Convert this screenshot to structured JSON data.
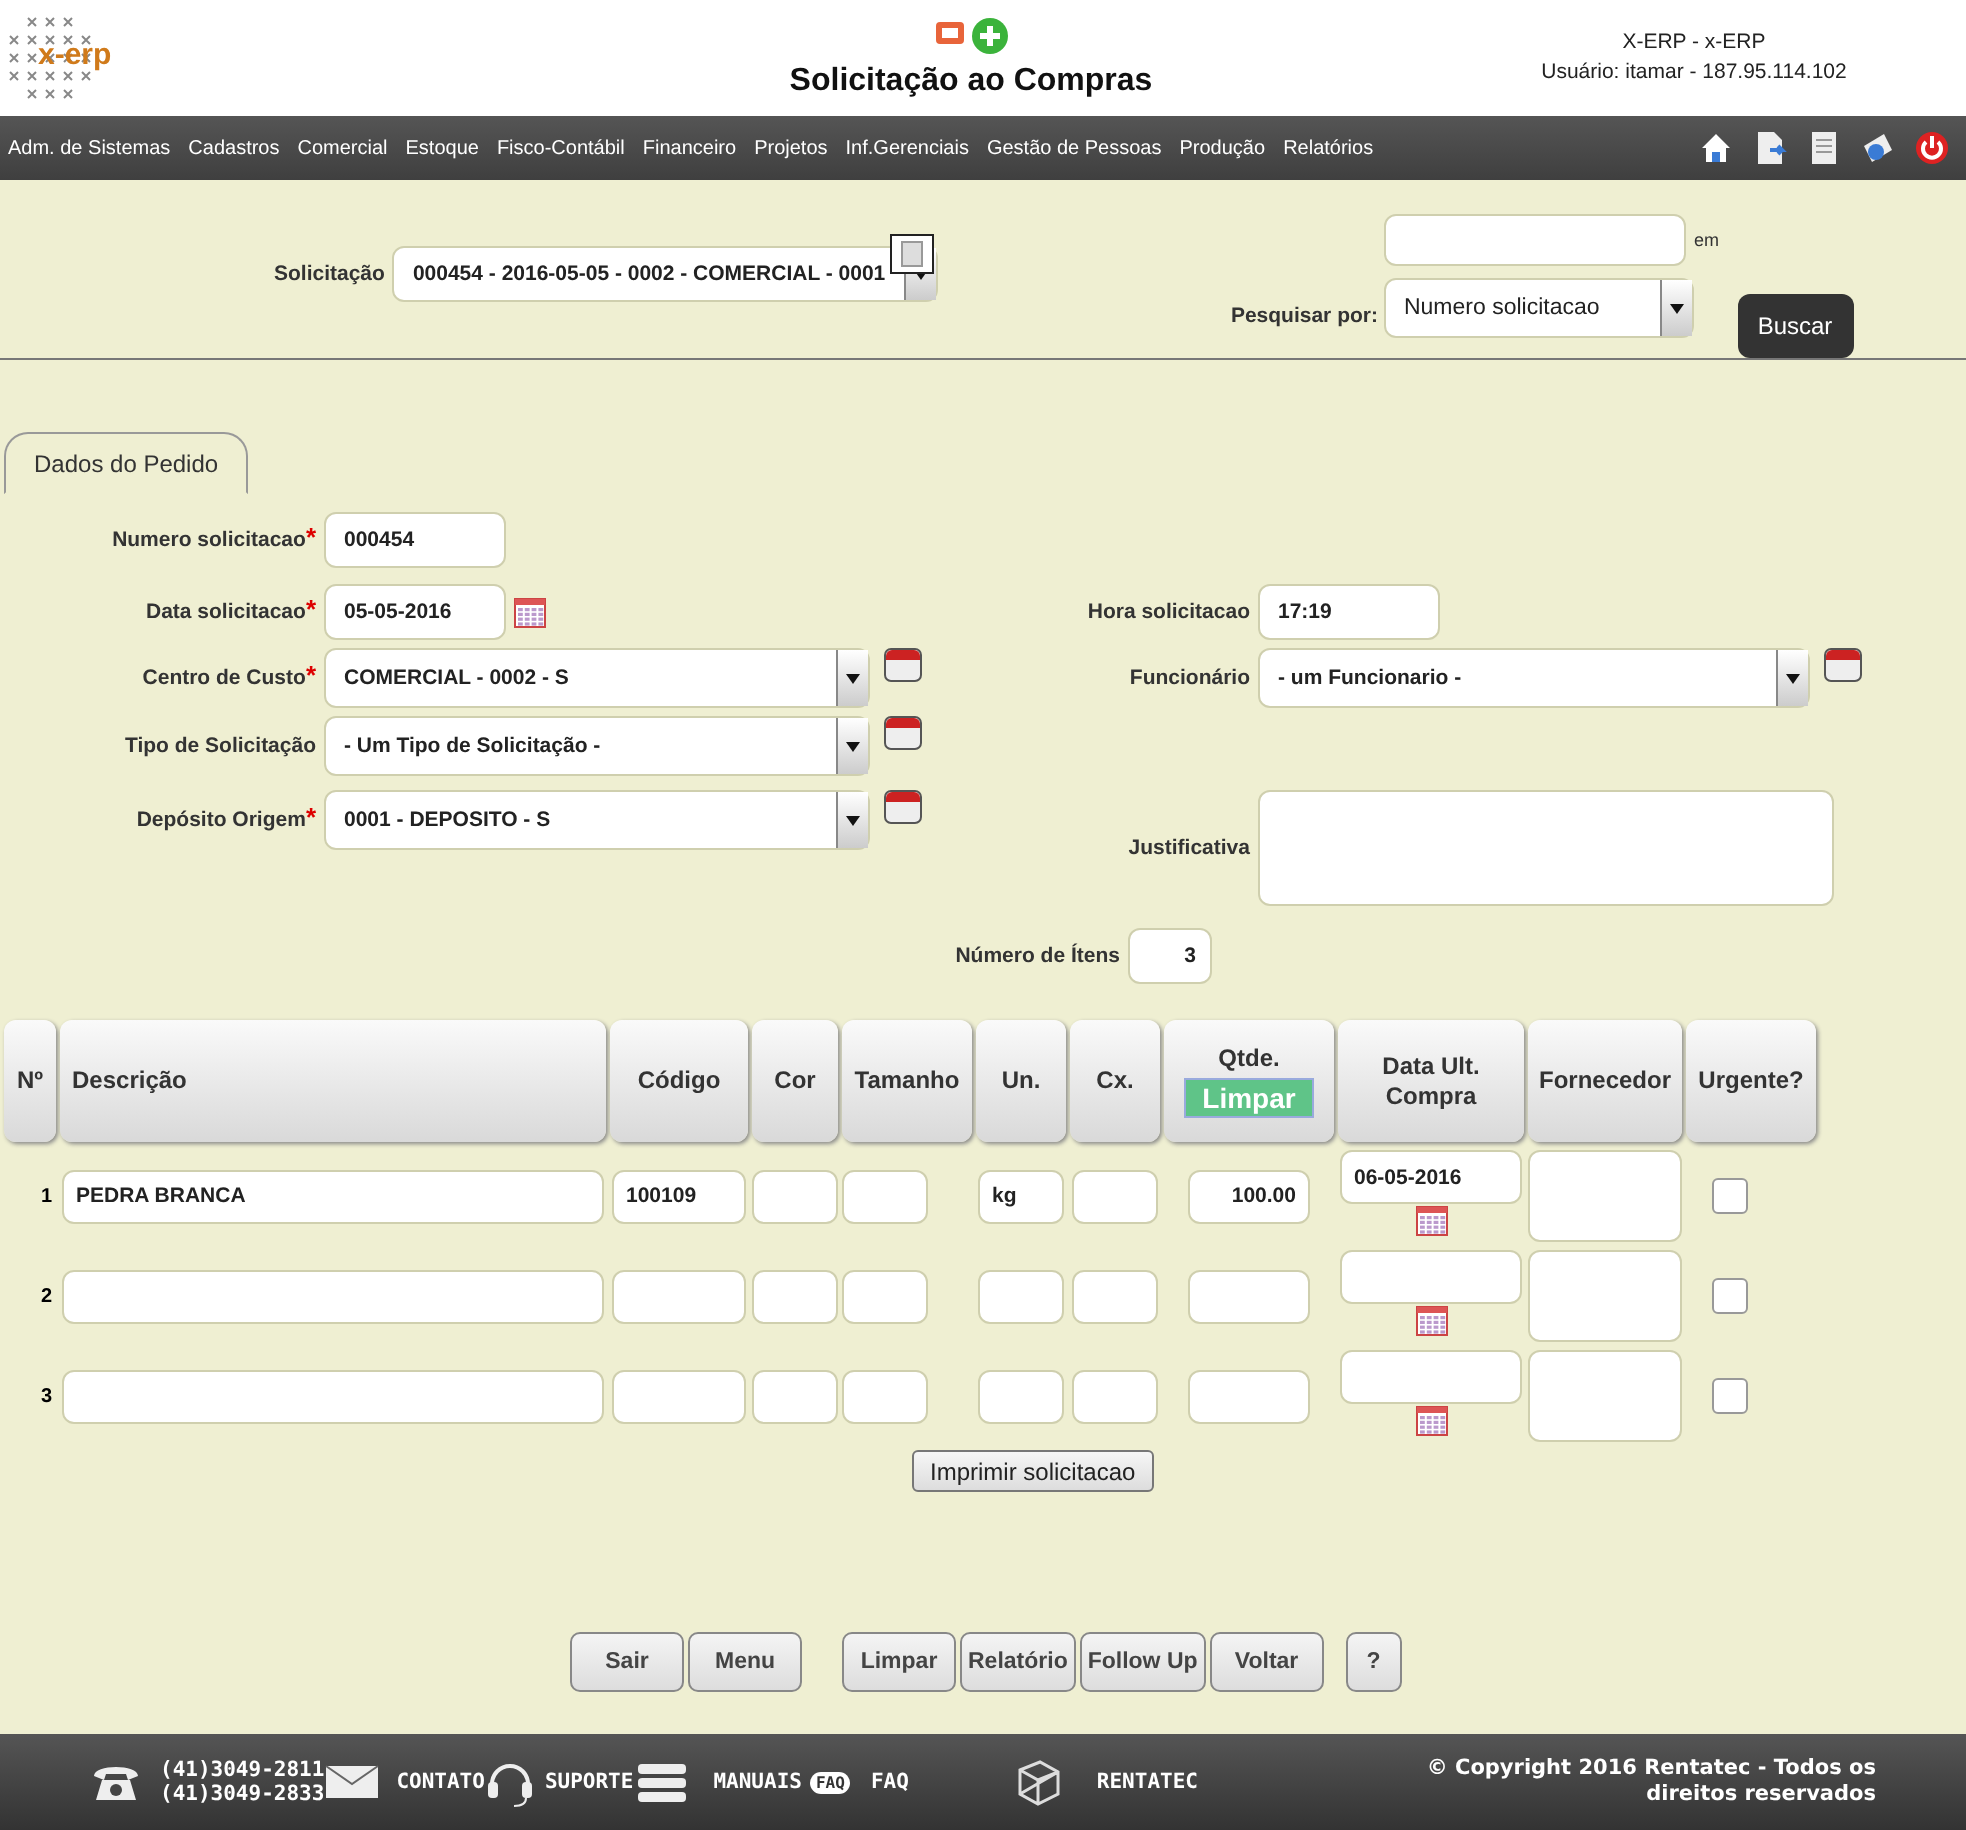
{
  "header": {
    "logo_text": "x-erp",
    "title": "Solicitação ao Compras",
    "system": "X-ERP - x-ERP",
    "user": "Usuário: itamar - 187.95.114.102"
  },
  "menu": [
    "Adm. de Sistemas",
    "Cadastros",
    "Comercial",
    "Estoque",
    "Fisco-Contábil",
    "Financeiro",
    "Projetos",
    "Inf.Gerenciais",
    "Gestão de Pessoas",
    "Produção",
    "Relatórios"
  ],
  "search": {
    "solicitacao_label": "Solicitação",
    "solicitacao_value": "000454 - 2016-05-05 - 0002 - COMERCIAL - 0001",
    "label": "Pesquisar por:",
    "suffix": "em",
    "field_value": "Numero solicitacao",
    "button": "Buscar"
  },
  "tabs": [
    {
      "label": "Dados do Pedido",
      "selected": true
    }
  ],
  "form": [
    {
      "left": {
        "label": "Numero solicitacao",
        "required": true,
        "kind": "text",
        "value": "000454"
      }
    },
    {
      "left": {
        "label": "Data solicitacao",
        "required": true,
        "kind": "date",
        "value": "05-05-2016"
      },
      "right": {
        "label": "Hora solicitacao",
        "required": false,
        "kind": "text",
        "value": "17:19"
      }
    },
    {
      "left": {
        "label": "Centro de Custo",
        "required": true,
        "kind": "select",
        "value": "COMERCIAL - 0002 - S"
      },
      "right": {
        "label": "Funcionário",
        "required": false,
        "kind": "select",
        "value": "- um Funcionario -"
      }
    },
    {
      "left": {
        "label": "Tipo de Solicitação",
        "required": false,
        "kind": "select",
        "value": "- Um Tipo de Solicitação -"
      }
    },
    {
      "left": {
        "label": "Depósito Origem",
        "required": true,
        "kind": "select",
        "value": "0001 - DEPOSITO - S"
      },
      "right": {
        "label": "Justificativa",
        "required": false,
        "kind": "textarea"
      }
    }
  ],
  "required_mark": "*",
  "items_count": {
    "label": "Número de Ítens",
    "value": "3"
  },
  "table": {
    "columns": [
      "Nº",
      "Descrição",
      "Código",
      "Cor",
      "Tamanho",
      "Un.",
      "Cx.",
      "Qtde.",
      "Data Ult. Compra",
      "Fornecedor",
      "Urgente?"
    ],
    "clear_button": "Limpar",
    "rows": [
      {
        "number": "1",
        "descricao": "PEDRA BRANCA",
        "codigo": "100109",
        "un": "kg",
        "qtde": "100.00",
        "data": "06-05-2016",
        "urgent": false
      },
      {
        "number": "2",
        "urgent": false
      },
      {
        "number": "3",
        "urgent": false
      }
    ]
  },
  "print_button": "Imprimir solicitacao",
  "actions": [
    [
      "Sair",
      "Menu"
    ],
    [
      "Limpar",
      "Relatório",
      "Follow Up",
      "Voltar"
    ],
    [
      "?"
    ]
  ],
  "footer": {
    "phones": [
      "(41)3049-2811",
      "(41)3049-2833"
    ],
    "contact": "CONTATO",
    "support": "SUPORTE",
    "manuals": "MANUAIS",
    "faq_badge": "FAQ",
    "faq": "FAQ",
    "company": "RENTATEC",
    "copyright": "© Copyright 2016 Rentatec - Todos os direitos reservados"
  }
}
